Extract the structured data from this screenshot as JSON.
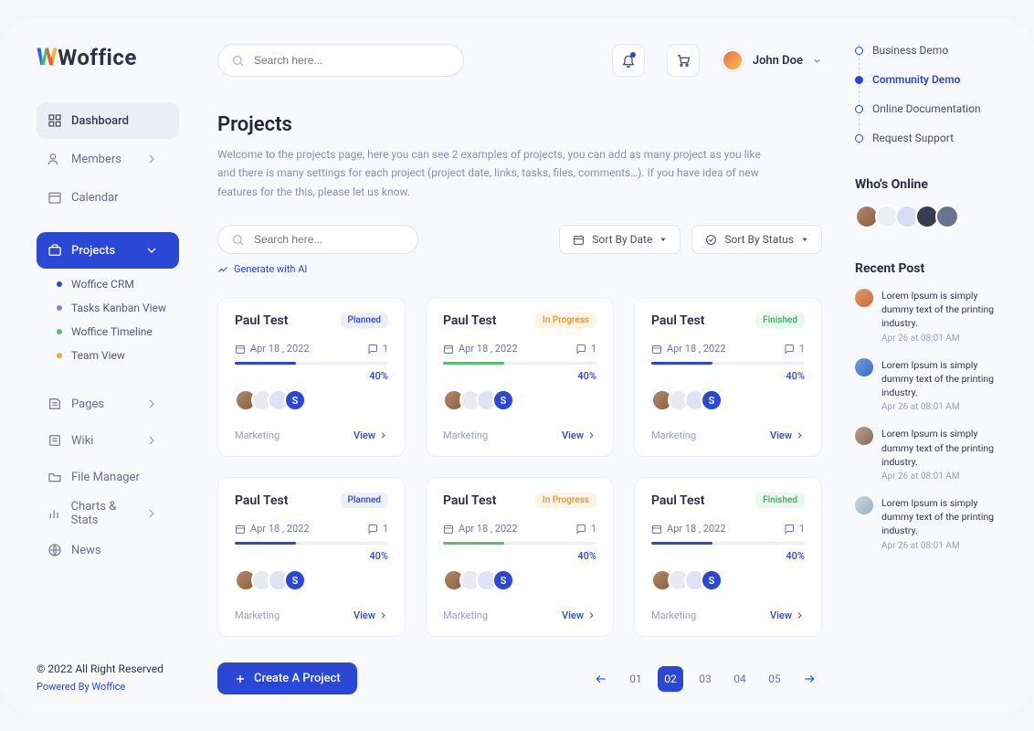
{
  "brand": {
    "name": "Woffice"
  },
  "header": {
    "search_placeholder": "Search here...",
    "user_name": "John Doe"
  },
  "sidebar": {
    "items": [
      {
        "label": "Dashboard",
        "kind": "subtle"
      },
      {
        "label": "Members",
        "kind": "chev"
      },
      {
        "label": "Calendar",
        "kind": "plain"
      }
    ],
    "projects": {
      "label": "Projects"
    },
    "sub_items": [
      {
        "label": "Woffice CRM",
        "color": "#2b47d6"
      },
      {
        "label": "Tasks Kanban View",
        "color": "#8b79f1"
      },
      {
        "label": "Woffice Timeline",
        "color": "#55c06b"
      },
      {
        "label": "Team View",
        "color": "#f0a63b"
      }
    ],
    "rest": [
      {
        "label": "Pages",
        "kind": "chev"
      },
      {
        "label": "Wiki",
        "kind": "chev"
      },
      {
        "label": "File Manager",
        "kind": "plain"
      },
      {
        "label": "Charts & Stats",
        "kind": "chev"
      },
      {
        "label": "News",
        "kind": "plain"
      }
    ],
    "footer": {
      "copyright": "© 2022 All Right Reserved",
      "powered": "Powered By Woffice"
    }
  },
  "page": {
    "title": "Projects",
    "description": "Welcome to the projects page, here you can see 2 examples of projects, you can add as many project as you like and there is many settings for each project (project date, links, tasks, files, comments…). If you have idea of new features for the this, please let us know.",
    "small_search_placeholder": "Search here...",
    "ai_link": "Generate with AI",
    "sort_date": "Sort By Date",
    "sort_status": "Sort By Status"
  },
  "projects": [
    {
      "title": "Paul Test",
      "status": "Planned",
      "status_cls": "planned",
      "date": "Apr 18 , 2022",
      "comments": "1",
      "progress": "40%",
      "bar_color": "#2b47d6",
      "category": "Marketing",
      "view": "View"
    },
    {
      "title": "Paul Test",
      "status": "In Progress",
      "status_cls": "inprogress",
      "date": "Apr 18 , 2022",
      "comments": "1",
      "progress": "40%",
      "bar_color": "#55c06b",
      "category": "Marketing",
      "view": "View"
    },
    {
      "title": "Paul Test",
      "status": "Finished",
      "status_cls": "finished",
      "date": "Apr 18 , 2022",
      "comments": "1",
      "progress": "40%",
      "bar_color": "#2b47d6",
      "category": "Marketing",
      "view": "View"
    },
    {
      "title": "Paul Test",
      "status": "Planned",
      "status_cls": "planned",
      "date": "Apr 18 , 2022",
      "comments": "1",
      "progress": "40%",
      "bar_color": "#2b47d6",
      "category": "Marketing",
      "view": "View"
    },
    {
      "title": "Paul Test",
      "status": "In Progress",
      "status_cls": "inprogress",
      "date": "Apr 18 , 2022",
      "comments": "1",
      "progress": "40%",
      "bar_color": "#55c06b",
      "category": "Marketing",
      "view": "View"
    },
    {
      "title": "Paul Test",
      "status": "Finished",
      "status_cls": "finished",
      "date": "Apr 18 , 2022",
      "comments": "1",
      "progress": "40%",
      "bar_color": "#2b47d6",
      "category": "Marketing",
      "view": "View"
    }
  ],
  "actions": {
    "create": "Create A Project"
  },
  "pager": {
    "pages": [
      "01",
      "02",
      "03",
      "04",
      "05"
    ],
    "active": 1
  },
  "quick_links": [
    {
      "label": "Business Demo",
      "active": false
    },
    {
      "label": "Community Demo",
      "active": true
    },
    {
      "label": "Online Documentation",
      "active": false
    },
    {
      "label": "Request Support",
      "active": false
    }
  ],
  "right": {
    "online_label": "Who's Online",
    "recent_label": "Recent Post",
    "posts": [
      {
        "msg": "Lorem Ipsum is simply dummy text of the printing industry.",
        "time": "Apr 26 at 08:01 AM"
      },
      {
        "msg": "Lorem Ipsum is simply dummy text of the printing industry.",
        "time": "Apr 26 at 08:01 AM"
      },
      {
        "msg": "Lorem Ipsum is simply dummy text of the printing industry.",
        "time": "Apr 26 at 08:01 AM"
      },
      {
        "msg": "Lorem Ipsum is simply dummy text of the printing industry.",
        "time": "Apr 26 at 08:01 AM"
      }
    ]
  }
}
